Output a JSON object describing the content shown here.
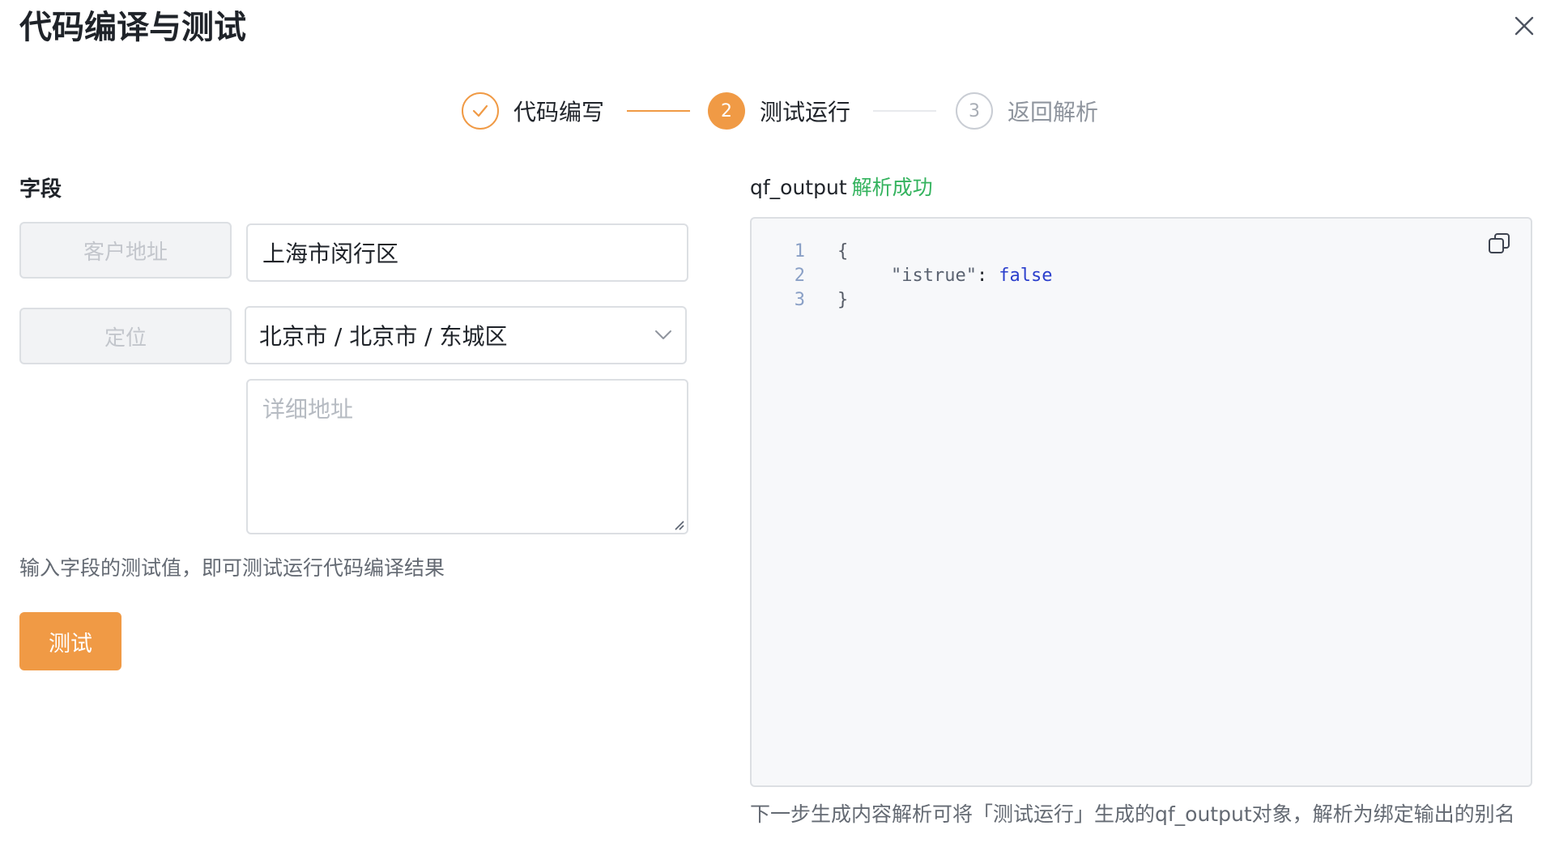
{
  "dialog": {
    "title": "代码编译与测试"
  },
  "steps": [
    {
      "label": "代码编写",
      "state": "done",
      "icon": "check-icon"
    },
    {
      "label": "测试运行",
      "state": "active",
      "number": "2"
    },
    {
      "label": "返回解析",
      "state": "pending",
      "number": "3"
    }
  ],
  "fields": {
    "section_label": "字段",
    "address_tag": "客户地址",
    "address_value": "上海市闵行区",
    "location_tag": "定位",
    "location_value": "北京市 / 北京市 / 东城区",
    "detail_placeholder": "详细地址",
    "hint": "输入字段的测试值，即可测试运行代码编译结果",
    "test_button": "测试"
  },
  "output": {
    "name": "qf_output",
    "status": "解析成功",
    "code": [
      {
        "ln": "1",
        "open_brace": "{"
      },
      {
        "ln": "2",
        "key": "\"istrue\"",
        "colon": ":",
        "value": "false"
      },
      {
        "ln": "3",
        "close_brace": "}"
      }
    ],
    "footnote": "下一步生成内容解析可将「测试运行」生成的qf_output对象，解析为绑定输出的别名"
  },
  "colors": {
    "accent": "#f09a45",
    "success": "#34b35e",
    "keyword_bool": "#2b3fcc"
  }
}
